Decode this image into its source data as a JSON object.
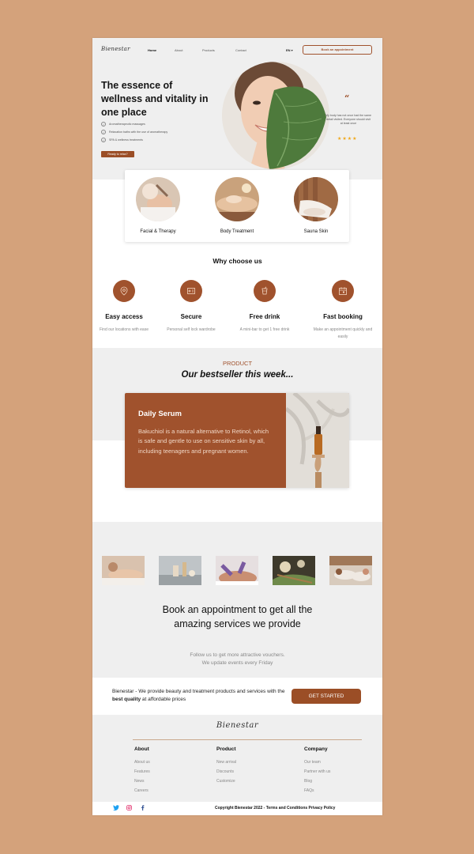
{
  "brand": {
    "logo": "Bienestar",
    "accent": "#a0522d",
    "page_bg": "#d4a27b"
  },
  "nav": {
    "items": [
      "Home",
      "About",
      "Products",
      "Contact"
    ],
    "lang": "EN ▾",
    "appointment_btn": "Book an appointment"
  },
  "hero": {
    "title": "The essence of wellness and vitality in one place",
    "checks": [
      "Aromatherapeutic massages",
      "Relaxation baths with the use of aromatherapy",
      "SPA & wellness treatments"
    ],
    "cta": "Ready to relax?",
    "quote_mark": "“",
    "testimonial": "My body has not once had the same detail visited. Everyone should visit at least once",
    "stars": "★★★★"
  },
  "services": [
    {
      "label": "Facial & Therapy",
      "icon": "facial-photo"
    },
    {
      "label": "Body Treatment",
      "icon": "body-treatment-photo"
    },
    {
      "label": "Sauna Skin",
      "icon": "sauna-photo"
    }
  ],
  "why": {
    "title": "Why choose us",
    "features": [
      {
        "title": "Easy access",
        "desc": "Find our locations with ease",
        "icon": "location-pin-icon"
      },
      {
        "title": "Secure",
        "desc": "Personal self lock wardrobe",
        "icon": "lock-box-icon"
      },
      {
        "title": "Free drink",
        "desc": "A mini-bar to get 1 free drink",
        "icon": "drink-icon"
      },
      {
        "title": "Fast booking",
        "desc": "Make an appointment quickly and easily",
        "icon": "calendar-icon"
      }
    ]
  },
  "product": {
    "kicker": "PRODUCT",
    "title": "Our bestseller this week...",
    "name": "Daily Serum",
    "desc": "Bakuchiol is a natural alternative to Retinol, which is safe and gentle to use on sensitive skin by all, including teenagers and pregnant women."
  },
  "booking": {
    "title": "Book an appointment to get all the amazing services we provide",
    "sub_1": "Follow us to get more attractive vouchers.",
    "sub_2": "We update events every Friday"
  },
  "bar": {
    "text_1": "Bienestar - We provide beauty and treatment products and services with the ",
    "text_bold": "best quality",
    "text_2": " at affordable prices",
    "button": "GET STARTED"
  },
  "footer": {
    "logo": "Bienestar",
    "columns": [
      {
        "title": "About",
        "links": [
          "About us",
          "Features",
          "News",
          "Careers"
        ]
      },
      {
        "title": "Product",
        "links": [
          "New arrival",
          "Discounts",
          "Customize"
        ]
      },
      {
        "title": "Company",
        "links": [
          "Our team",
          "Partner with us",
          "Blog",
          "FAQs"
        ]
      }
    ],
    "copyright": "Copyright Bienestar 2022 - Terms and Conditions Privacy Policy",
    "social": [
      "twitter-icon",
      "instagram-icon",
      "facebook-icon"
    ]
  }
}
